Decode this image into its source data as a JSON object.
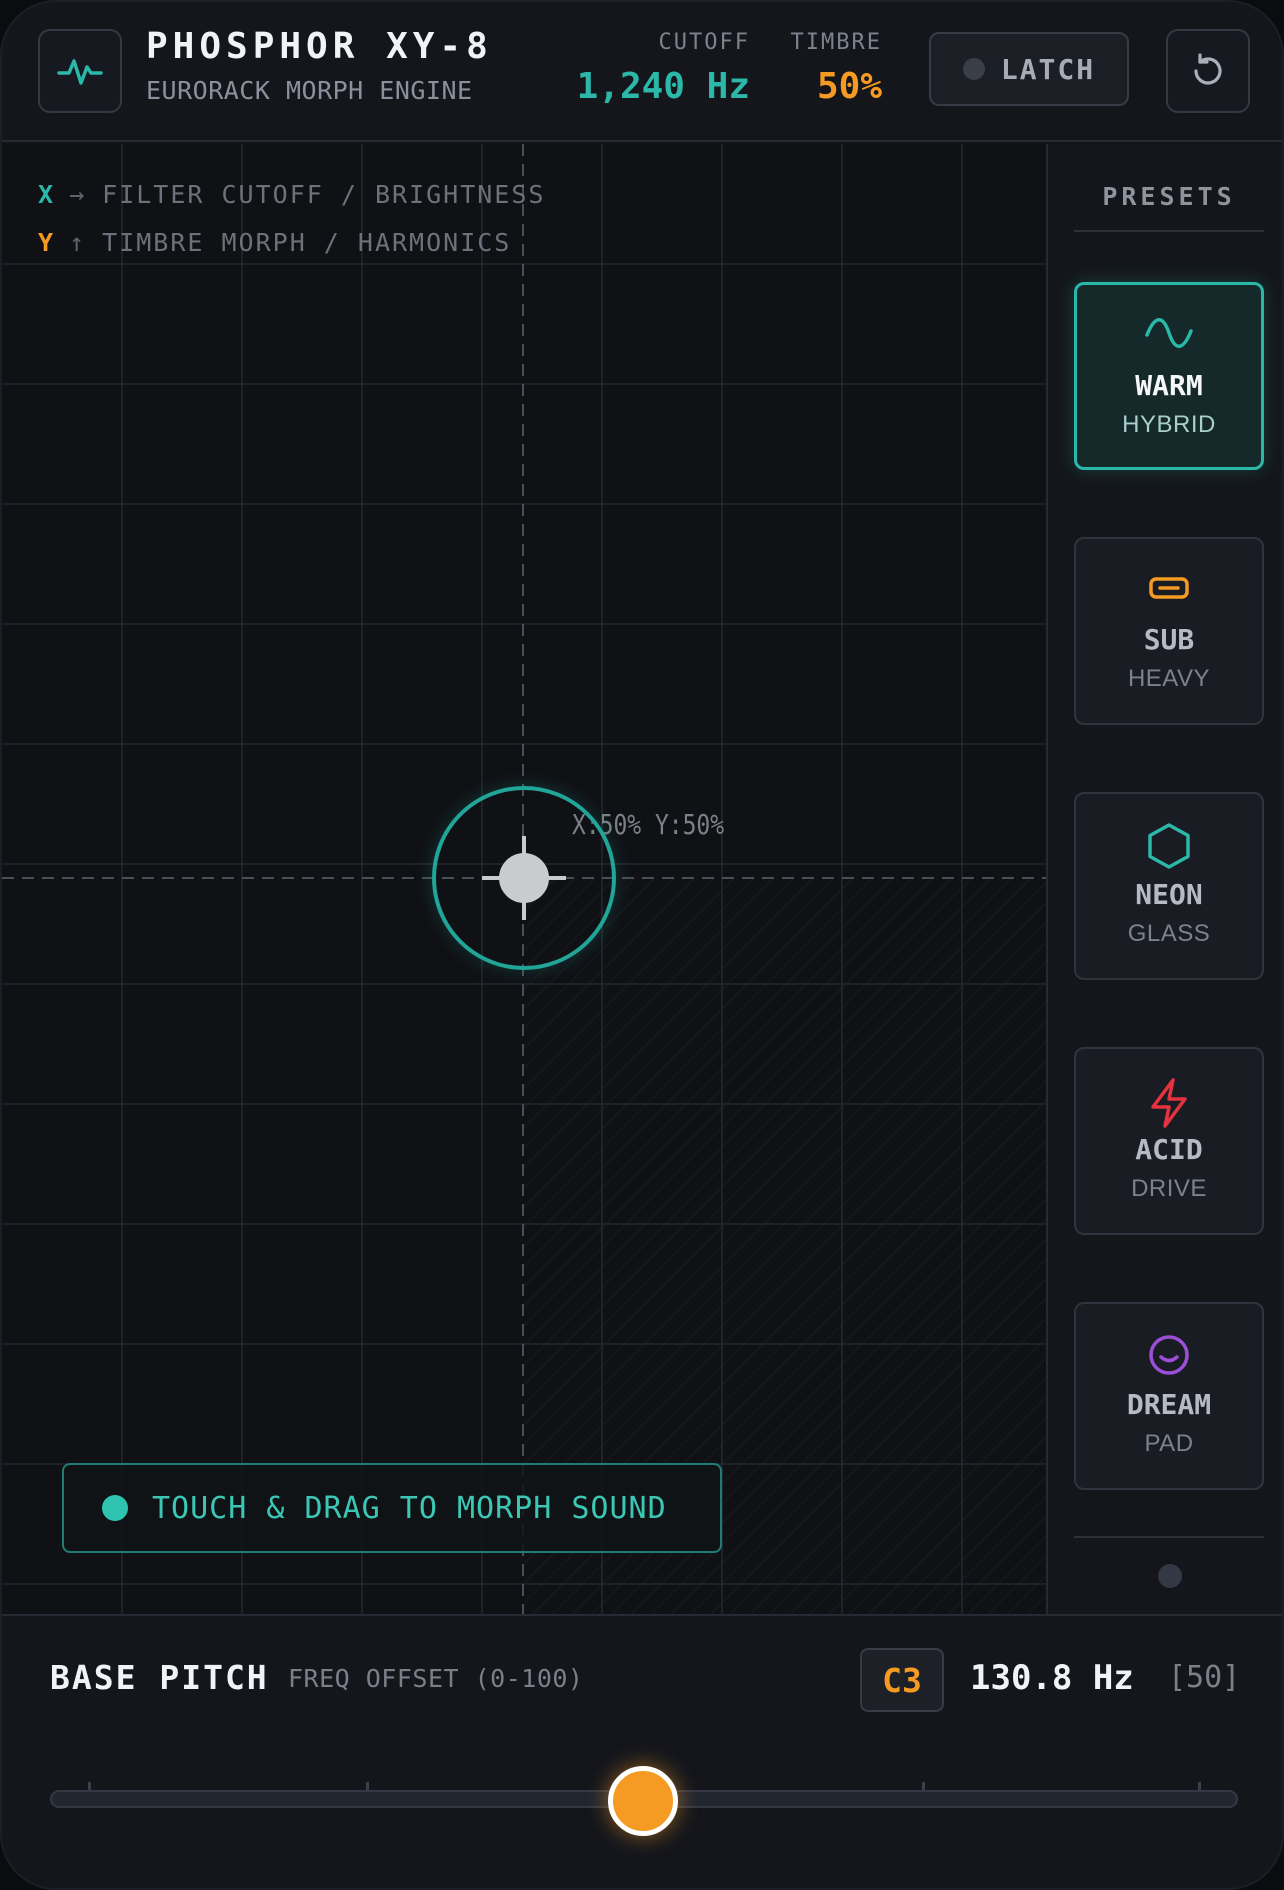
{
  "header": {
    "title": "PHOSPHOR XY-8",
    "subtitle": "EURORACK MORPH ENGINE",
    "cutoff_label": "CUTOFF",
    "cutoff_value": "1,240 Hz",
    "timbre_label": "TIMBRE",
    "timbre_value": "50%",
    "latch_label": "LATCH",
    "logo_icon": "pulse-icon",
    "reset_icon": "reset-icon"
  },
  "pad": {
    "x_axis_letter": "X",
    "x_axis_arrow": "→",
    "x_axis_label": "FILTER CUTOFF / BRIGHTNESS",
    "y_axis_letter": "Y",
    "y_axis_arrow": "↑",
    "y_axis_label": "TIMBRE MORPH / HARMONICS",
    "cursor_x": 0.5,
    "cursor_y": 0.5,
    "coord_text": "X:50% Y:50%",
    "hint_text": "TOUCH & DRAG TO MORPH SOUND"
  },
  "presets": {
    "title": "PRESETS",
    "items": [
      {
        "name": "WARM",
        "sub": "HYBRID",
        "icon": "sine-wave-icon",
        "color": "#2bb8a8",
        "active": true
      },
      {
        "name": "SUB",
        "sub": "HEAVY",
        "icon": "rounded-rect-icon",
        "color": "#f59a23",
        "active": false
      },
      {
        "name": "NEON",
        "sub": "GLASS",
        "icon": "hexagon-icon",
        "color": "#2bb8a8",
        "active": false
      },
      {
        "name": "ACID",
        "sub": "DRIVE",
        "icon": "lightning-icon",
        "color": "#e5323f",
        "active": false
      },
      {
        "name": "DREAM",
        "sub": "PAD",
        "icon": "smile-icon",
        "color": "#9b4fd6",
        "active": false
      }
    ]
  },
  "bottom": {
    "title": "BASE PITCH",
    "subtitle": "FREQ OFFSET (0-100)",
    "note": "C3",
    "freq": "130.8 Hz",
    "offset_display": "[50]",
    "slider_value": 50
  },
  "colors": {
    "teal": "#2bb8a8",
    "orange": "#f59a23",
    "red": "#e5323f",
    "purple": "#9b4fd6"
  }
}
